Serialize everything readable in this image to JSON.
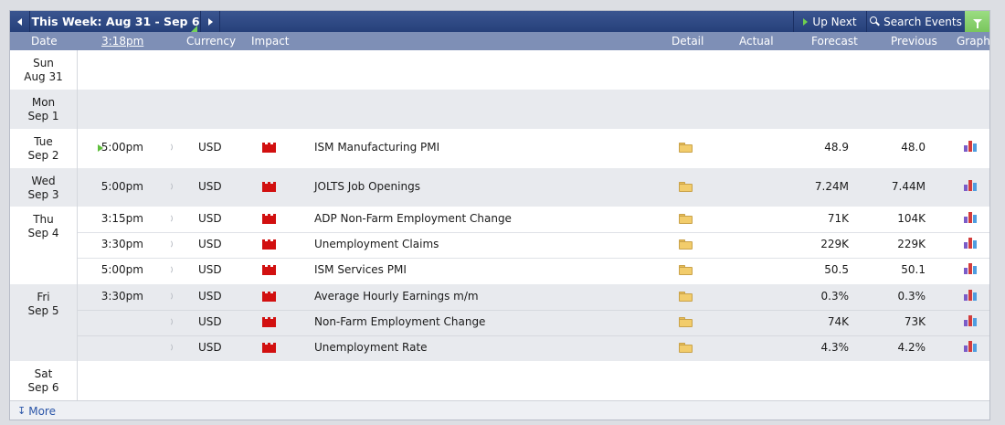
{
  "topbar": {
    "week_label": "This Week: Aug 31 - Sep 6",
    "up_next_label": "Up Next",
    "search_label": "Search Events"
  },
  "header": {
    "date": "Date",
    "time": "3:18pm",
    "currency": "Currency",
    "impact": "Impact",
    "detail": "Detail",
    "actual": "Actual",
    "forecast": "Forecast",
    "previous": "Previous",
    "graph": "Graph"
  },
  "days": [
    {
      "dow": "Sun",
      "date": "Aug 31"
    },
    {
      "dow": "Mon",
      "date": "Sep 1"
    },
    {
      "dow": "Tue",
      "date": "Sep 2"
    },
    {
      "dow": "Wed",
      "date": "Sep 3"
    },
    {
      "dow": "Thu",
      "date": "Sep 4"
    },
    {
      "dow": "Fri",
      "date": "Sep 5"
    },
    {
      "dow": "Sat",
      "date": "Sep 6"
    }
  ],
  "events": [
    {
      "time": "5:00pm",
      "currency": "USD",
      "event": "ISM Manufacturing PMI",
      "actual": "",
      "forecast": "48.9",
      "previous": "48.0"
    },
    {
      "time": "5:00pm",
      "currency": "USD",
      "event": "JOLTS Job Openings",
      "actual": "",
      "forecast": "7.24M",
      "previous": "7.44M"
    },
    {
      "time": "3:15pm",
      "currency": "USD",
      "event": "ADP Non-Farm Employment Change",
      "actual": "",
      "forecast": "71K",
      "previous": "104K"
    },
    {
      "time": "3:30pm",
      "currency": "USD",
      "event": "Unemployment Claims",
      "actual": "",
      "forecast": "229K",
      "previous": "229K"
    },
    {
      "time": "5:00pm",
      "currency": "USD",
      "event": "ISM Services PMI",
      "actual": "",
      "forecast": "50.5",
      "previous": "50.1"
    },
    {
      "time": "3:30pm",
      "currency": "USD",
      "event": "Average Hourly Earnings m/m",
      "actual": "",
      "forecast": "0.3%",
      "previous": "0.3%"
    },
    {
      "time": "",
      "currency": "USD",
      "event": "Non-Farm Employment Change",
      "actual": "",
      "forecast": "74K",
      "previous": "73K"
    },
    {
      "time": "",
      "currency": "USD",
      "event": "Unemployment Rate",
      "actual": "",
      "forecast": "4.3%",
      "previous": "4.2%"
    }
  ],
  "footer": {
    "more_label": "More"
  },
  "icons": {
    "impact": "high-impact-icon",
    "detail": "folder-icon",
    "graph": "bar-graph-icon",
    "sound": "sound-icon",
    "next": "next-event-indicator-icon"
  },
  "colors": {
    "topbar": "#26407a",
    "header": "#7e8fb6",
    "day_alt": "#e8eaee",
    "impact_high": "#d40f0f",
    "filter": "#79c65d",
    "link": "#2a55a8"
  }
}
